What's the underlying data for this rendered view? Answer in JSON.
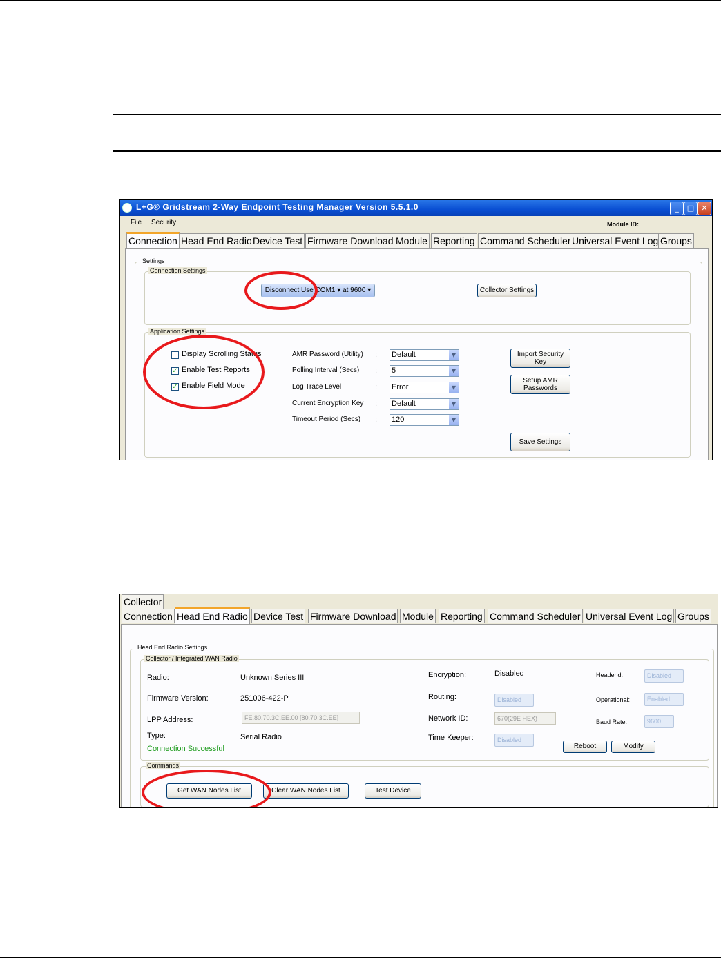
{
  "shot1": {
    "title": "L+G® Gridstream 2-Way Endpoint Testing Manager Version 5.5.1.0",
    "menu": [
      "File",
      "Security"
    ],
    "module_id_label": "Module ID:",
    "tabs": [
      "Connection",
      "Head End Radio",
      "Device Test",
      "Firmware Download",
      "Module",
      "Reporting",
      "Command Scheduler",
      "Universal Event Log",
      "Groups"
    ],
    "settings_label": "Settings",
    "connection_settings_label": "Connection Settings",
    "connect_combo": "Disconnect  Use COM1  ▾  at 9600  ▾",
    "collector_settings": "Collector Settings",
    "application_settings_label": "Application Settings",
    "checkboxes": [
      {
        "label": "Display Scrolling Status",
        "checked": false
      },
      {
        "label": "Enable Test Reports",
        "checked": true
      },
      {
        "label": "Enable Field Mode",
        "checked": true
      }
    ],
    "fields": [
      {
        "label": "AMR Password (Utility)",
        "value": "Default"
      },
      {
        "label": "Polling Interval (Secs)",
        "value": "5"
      },
      {
        "label": "Log Trace Level",
        "value": "Error"
      },
      {
        "label": "Current Encryption Key",
        "value": "Default"
      },
      {
        "label": "Timeout Period (Secs)",
        "value": "120"
      }
    ],
    "colon": ":",
    "import_key": [
      "Import Security",
      "Key"
    ],
    "setup_amr": [
      "Setup AMR",
      "Passwords"
    ],
    "save_settings": "Save Settings"
  },
  "shot2": {
    "top_tab": "Collector",
    "tabs": [
      "Connection",
      "Head End Radio",
      "Device Test",
      "Firmware Download",
      "Module",
      "Reporting",
      "Command Scheduler",
      "Universal Event Log",
      "Groups"
    ],
    "her_settings_label": "Head End Radio Settings",
    "collector_label": "Collector / Integrated WAN Radio",
    "radio_label": "Radio:",
    "radio_value": "Unknown Series III",
    "fw_label": "Firmware Version:",
    "fw_value": "251006-422-P",
    "lpp_label": "LPP Address:",
    "lpp_value": "FE.80.70.3C.EE.00 [80.70.3C.EE]",
    "type_label": "Type:",
    "type_value": "Serial Radio",
    "status": "Connection Successful",
    "encryption_label": "Encryption:",
    "encryption_value": "Disabled",
    "routing_label": "Routing:",
    "routing_value": "Disabled",
    "network_label": "Network ID:",
    "network_value": "670(29E HEX)",
    "timekeeper_label": "Time Keeper:",
    "timekeeper_value": "Disabled",
    "headend_label": "Headend:",
    "headend_value": "Disabled",
    "operational_label": "Operational:",
    "operational_value": "Enabled",
    "baud_label": "Baud Rate:",
    "baud_value": "9600",
    "reboot": "Reboot",
    "modify": "Modify",
    "commands_label": "Commands",
    "get_wan": "Get WAN Nodes List",
    "clear_wan": "Clear WAN Nodes List",
    "test_device": "Test Device"
  }
}
